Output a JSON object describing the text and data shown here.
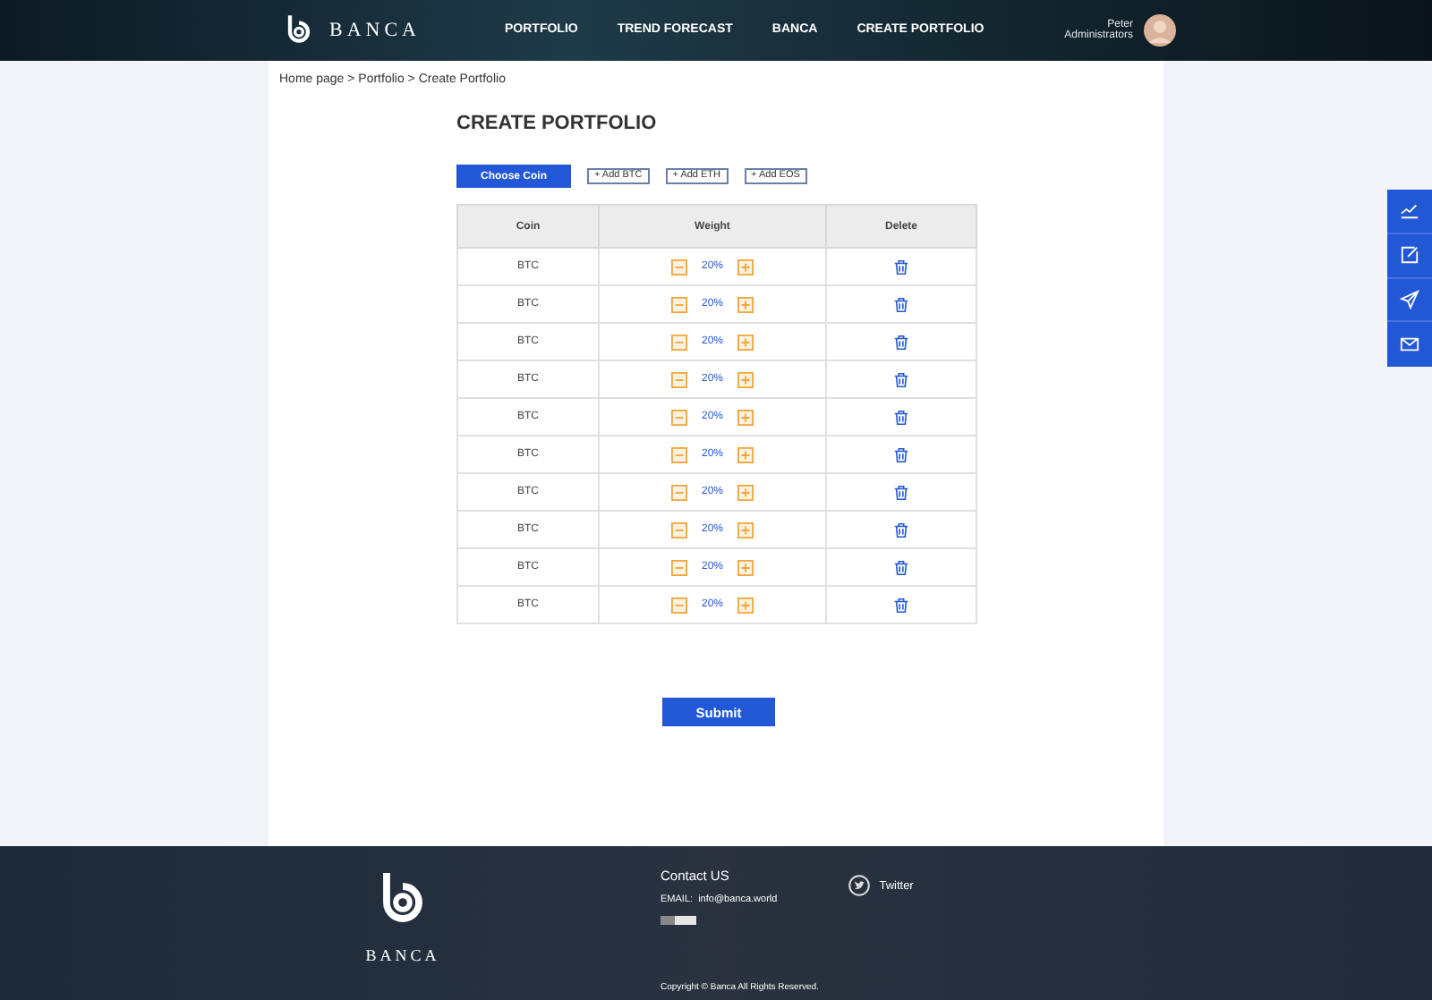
{
  "header": {
    "logo_text": "BANCA",
    "nav": [
      "PORTFOLIO",
      "TREND FORECAST",
      "BANCA",
      "CREATE PORTFOLIO"
    ],
    "user": {
      "name": "Peter",
      "role": "Administrators"
    }
  },
  "breadcrumb": "Home page > Portfolio > Create Portfolio",
  "title": "CREATE PORTFOLIO",
  "choose_button": "Choose Coin",
  "add_buttons": [
    "+ Add BTC",
    "+ Add ETH",
    "+ Add EOS"
  ],
  "table": {
    "columns": [
      "Coin",
      "Weight",
      "Delete"
    ],
    "rows": [
      {
        "coin": "BTC",
        "weight": "20%"
      },
      {
        "coin": "BTC",
        "weight": "20%"
      },
      {
        "coin": "BTC",
        "weight": "20%"
      },
      {
        "coin": "BTC",
        "weight": "20%"
      },
      {
        "coin": "BTC",
        "weight": "20%"
      },
      {
        "coin": "BTC",
        "weight": "20%"
      },
      {
        "coin": "BTC",
        "weight": "20%"
      },
      {
        "coin": "BTC",
        "weight": "20%"
      },
      {
        "coin": "BTC",
        "weight": "20%"
      },
      {
        "coin": "BTC",
        "weight": "20%"
      }
    ]
  },
  "submit": "Submit",
  "side_toolbar": [
    {
      "kind": "chart"
    },
    {
      "kind": "edit"
    },
    {
      "kind": "send"
    },
    {
      "kind": "mail"
    }
  ],
  "footer": {
    "logo_text": "BANCA",
    "contact_title": "Contact US",
    "email": "EMAIL:  info@banca.world",
    "twitter": "Twitter",
    "copyright": "Copyright © Banca All Rights Reserved."
  }
}
